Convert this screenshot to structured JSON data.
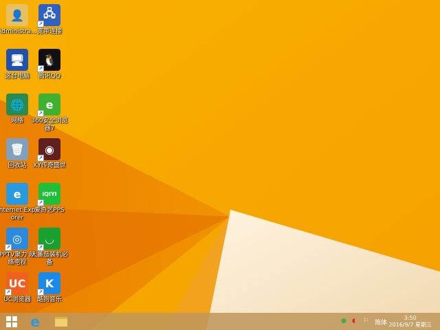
{
  "desktop": {
    "icons": [
      {
        "label": "Administra...",
        "icon": "user-folder-icon",
        "color": "#e8c060",
        "glyph": "👤",
        "shortcut": false
      },
      {
        "label": "宽带连接",
        "icon": "network-connection-icon",
        "color": "#3060c0",
        "glyph": "🖧",
        "shortcut": true
      },
      {
        "label": "这台电脑",
        "icon": "computer-icon",
        "color": "#2050b0",
        "glyph": "🖥",
        "shortcut": false
      },
      {
        "label": "腾讯QQ",
        "icon": "qq-icon",
        "color": "#111111",
        "glyph": "🐧",
        "shortcut": true
      },
      {
        "label": "网络",
        "icon": "network-globe-icon",
        "color": "#2a8a50",
        "glyph": "🌐",
        "shortcut": false
      },
      {
        "label": "360安全浏览器7",
        "icon": "browser-360-icon",
        "color": "#40b030",
        "glyph": "e",
        "shortcut": true
      },
      {
        "label": "回收站",
        "icon": "recycle-bin-icon",
        "color": "#80a0c0",
        "glyph": "🗑",
        "shortcut": false
      },
      {
        "label": "XY传奇盛世",
        "icon": "game-icon",
        "color": "#602020",
        "glyph": "◉",
        "shortcut": true
      },
      {
        "label": "Internet Explorer",
        "icon": "internet-explorer-icon",
        "color": "#2a9ae0",
        "glyph": "e",
        "shortcut": false
      },
      {
        "label": "爱奇艺PPS",
        "icon": "iqiyi-icon",
        "color": "#1fbf3a",
        "glyph": "iQIYI",
        "shortcut": true
      },
      {
        "label": "PPTV聚力 网络电视",
        "icon": "pptv-icon",
        "color": "#2a8ae0",
        "glyph": "◎",
        "shortcut": true
      },
      {
        "label": "大番茄装机必备",
        "icon": "shopping-bag-icon",
        "color": "#18a030",
        "glyph": "◡",
        "shortcut": true
      },
      {
        "label": "UC浏览器",
        "icon": "uc-browser-icon",
        "color": "#f06020",
        "glyph": "UC",
        "shortcut": true
      },
      {
        "label": "酷狗音乐",
        "icon": "kugou-icon",
        "color": "#1a8ae8",
        "glyph": "K",
        "shortcut": true
      }
    ]
  },
  "taskbar": {
    "start": "windows-start-icon",
    "pinned": [
      "internet-explorer-icon",
      "file-explorer-icon"
    ],
    "tray": {
      "ime": "简体",
      "time": "3:50",
      "date": "2016/9/7 星期三"
    }
  }
}
